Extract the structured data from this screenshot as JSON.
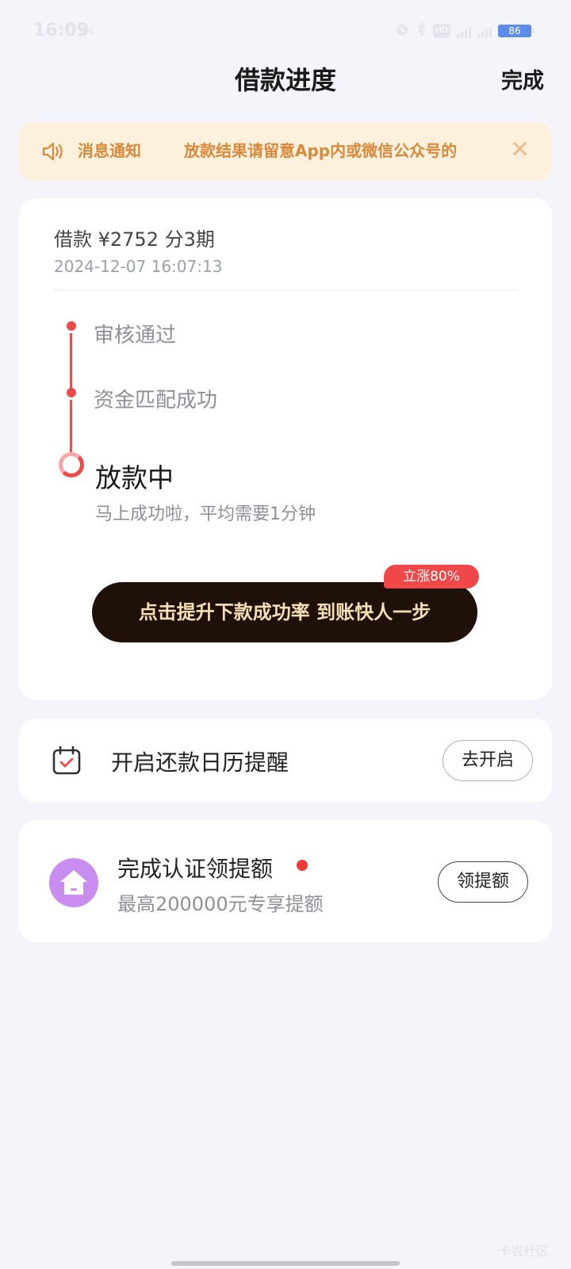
{
  "status_bar": {
    "time": "16:09",
    "small_text": "6/s",
    "signal_label_1": "5G",
    "signal_label_2": "5G",
    "hd_label": "HD",
    "battery": "86"
  },
  "header": {
    "title": "借款进度",
    "done_label": "完成"
  },
  "notice": {
    "label": "消息通知",
    "text": "放款结果请留意App内或微信公众号的",
    "close_glyph": "×"
  },
  "loan": {
    "summary": "借款 ¥2752  分3期",
    "time": "2024-12-07 16:07:13",
    "steps": [
      {
        "label": "审核通过",
        "status": "done"
      },
      {
        "label": "资金匹配成功",
        "status": "done"
      },
      {
        "label": "放款中",
        "status": "current"
      }
    ],
    "current_desc": "马上成功啦，平均需要1分钟",
    "boost_button": "点击提升下款成功率 到账快人一步",
    "boost_badge": "立涨80%"
  },
  "calendar_card": {
    "text": "开启还款日历提醒",
    "button": "去开启"
  },
  "credit_card": {
    "title": "完成认证领提额",
    "subtitle": "最高200000元专享提额",
    "button": "领提额"
  },
  "watermark": "卡农社区",
  "colors": {
    "accent_red": "#ef4a4a",
    "notice_bg": "#fdf0dc",
    "notice_text": "#d8893a",
    "button_dark": "#1f100a",
    "button_text": "#f6dfb5",
    "avatar_purple": "#c98cf0"
  }
}
